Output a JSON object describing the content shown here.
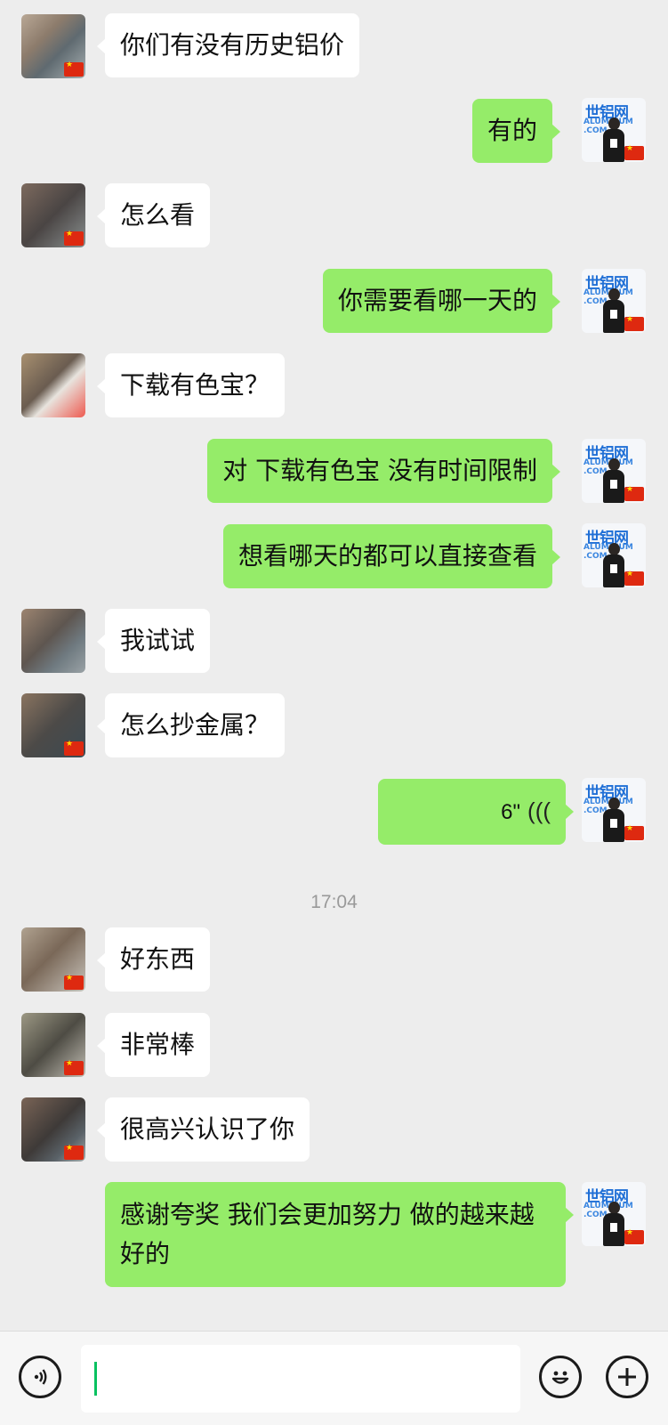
{
  "messages": [
    {
      "side": "left",
      "text": "你们有没有历史铝价"
    },
    {
      "side": "right",
      "text": "有的"
    },
    {
      "side": "left",
      "text": "怎么看"
    },
    {
      "side": "right",
      "text": "你需要看哪一天的"
    },
    {
      "side": "left",
      "text": "下载有色宝？"
    },
    {
      "side": "right",
      "text": "对 下载有色宝 没有时间限制"
    },
    {
      "side": "right",
      "text": "想看哪天的都可以直接查看"
    },
    {
      "side": "left",
      "text": "我试试"
    },
    {
      "side": "left",
      "text": "怎么抄金属？"
    },
    {
      "side": "right",
      "voice_duration": "6\""
    },
    {
      "side": "left",
      "text": "好东西"
    },
    {
      "side": "left",
      "text": "非常棒"
    },
    {
      "side": "left",
      "text": "很高兴认识了你"
    },
    {
      "side": "right",
      "text": "感谢夸奖 我们会更加努力 做的越来越好的"
    }
  ],
  "timestamp": "17:04",
  "my_avatar": {
    "logo_text": "世铝网",
    "logo_sub": "ALUMINUM .COM"
  },
  "colors": {
    "background": "#ededed",
    "sent_bubble": "#95ec69",
    "received_bubble": "#ffffff",
    "caret": "#07c160"
  },
  "input_bar": {
    "icons": [
      "voice-icon",
      "emoji-icon",
      "plus-icon"
    ]
  }
}
